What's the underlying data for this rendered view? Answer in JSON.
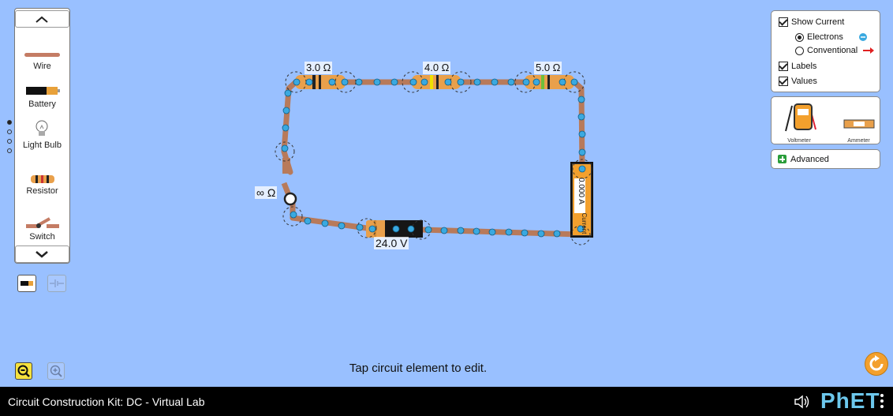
{
  "toolbox": {
    "items": [
      {
        "label": "Wire",
        "icon": "wire-icon"
      },
      {
        "label": "Battery",
        "icon": "battery-icon"
      },
      {
        "label": "Light Bulb",
        "icon": "light-bulb-icon"
      },
      {
        "label": "Resistor",
        "icon": "resistor-icon"
      },
      {
        "label": "Switch",
        "icon": "switch-icon"
      }
    ]
  },
  "circuit": {
    "resistor1": "3.0 Ω",
    "resistor2": "4.0 Ω",
    "resistor3": "5.0 Ω",
    "battery": "24.0 V",
    "switch_resistance": "∞ Ω",
    "ammeter_title": "Current",
    "ammeter_value": "0.000 A"
  },
  "options": {
    "show_current": "Show Current",
    "electrons": "Electrons",
    "conventional": "Conventional",
    "labels": "Labels",
    "values": "Values"
  },
  "instruments": {
    "voltmeter": "Voltmeter",
    "ammeter": "Ammeter"
  },
  "advanced": {
    "label": "Advanced"
  },
  "hint": "Tap circuit element to edit.",
  "navbar": {
    "title": "Circuit Construction Kit: DC - Virtual Lab",
    "brand": "PhET"
  },
  "colors": {
    "background": "#99c0ff",
    "wire": "#b87a5a",
    "electron": "#3aa9e0",
    "accent": "#f3a02d"
  }
}
